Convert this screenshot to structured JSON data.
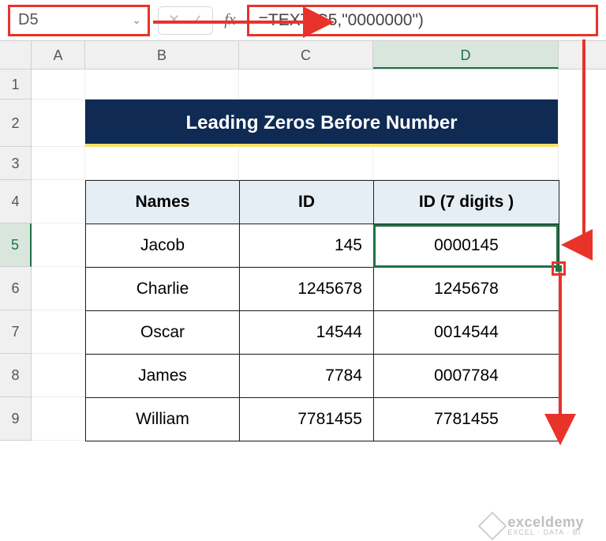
{
  "name_box": "D5",
  "formula": "=TEXT(C5,\"0000000\")",
  "columns": [
    "A",
    "B",
    "C",
    "D"
  ],
  "rows": [
    "1",
    "2",
    "3",
    "4",
    "5",
    "6",
    "7",
    "8",
    "9"
  ],
  "title": "Leading Zeros Before Number",
  "headers": {
    "b": "Names",
    "c": "ID",
    "d": "ID (7 digits )"
  },
  "data": [
    {
      "name": "Jacob",
      "id": "145",
      "id7": "0000145"
    },
    {
      "name": "Charlie",
      "id": "1245678",
      "id7": "1245678"
    },
    {
      "name": "Oscar",
      "id": "14544",
      "id7": "0014544"
    },
    {
      "name": "James",
      "id": "7784",
      "id7": "0007784"
    },
    {
      "name": "William",
      "id": "7781455",
      "id7": "7781455"
    }
  ],
  "watermark": {
    "l1": "exceldemy",
    "l2": "EXCEL · DATA · BI"
  }
}
